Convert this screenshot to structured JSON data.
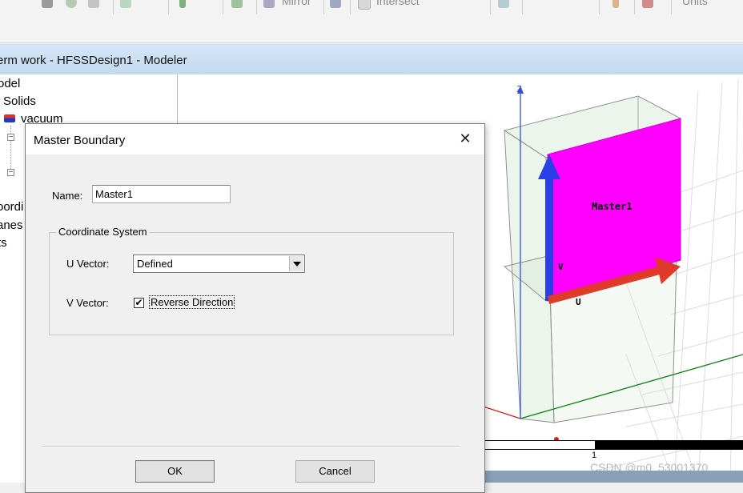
{
  "ribbon": {
    "mirror_label": "Mirror",
    "intersect_label": "Intersect",
    "units_label": "Units"
  },
  "window": {
    "title": "erm work - HFSSDesign1 - Modeler"
  },
  "tree": {
    "model_label": "odel",
    "solids_label": "Solids",
    "vacuum_label": "vacuum",
    "coordinate_label": "oordi",
    "planes_label": "anes",
    "lists_label": "ts"
  },
  "viewport": {
    "axis_z_label": "Z",
    "boundary_label": "Master1",
    "u_label": "U",
    "v_label": "V",
    "scale_label": "1",
    "watermark": "CSDN @m0_53001370",
    "colors": {
      "boundary_face": "#ff00ff",
      "u_arrow": "#e03a2a",
      "v_arrow": "#2b3fe6",
      "x_axis": "#d42020",
      "y_axis": "#108010",
      "z_axis": "#3050e0"
    }
  },
  "dialog": {
    "title": "Master Boundary",
    "name_label": "Name:",
    "name_value": "Master1",
    "group_label": "Coordinate System",
    "u_vector_label": "U  Vector:",
    "u_vector_value": "Defined",
    "v_vector_label": "V  Vector:",
    "reverse_direction_label": "Reverse Direction",
    "reverse_direction_checked": true,
    "ok_label": "OK",
    "cancel_label": "Cancel"
  }
}
